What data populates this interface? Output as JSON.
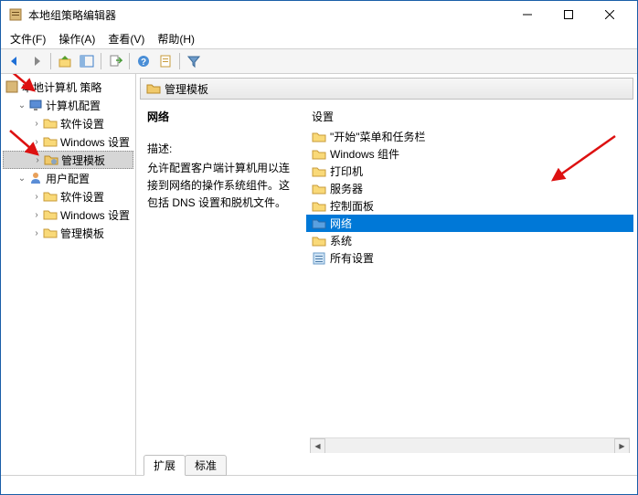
{
  "window": {
    "title": "本地组策略编辑器"
  },
  "menubar": {
    "file": "文件(F)",
    "action": "操作(A)",
    "view": "查看(V)",
    "help": "帮助(H)"
  },
  "tree": {
    "root": "本地计算机 策略",
    "computer_config": "计算机配置",
    "software_settings_1": "软件设置",
    "windows_settings_1": "Windows 设置",
    "admin_templates_1": "管理模板",
    "user_config": "用户配置",
    "software_settings_2": "软件设置",
    "windows_settings_2": "Windows 设置",
    "admin_templates_2": "管理模板"
  },
  "content": {
    "header": "管理模板",
    "details_title": "网络",
    "desc_label": "描述:",
    "description": "允许配置客户端计算机用以连接到网络的操作系统组件。这包括 DNS 设置和脱机文件。",
    "settings_label": "设置",
    "items": [
      "\"开始\"菜单和任务栏",
      "Windows 组件",
      "打印机",
      "服务器",
      "控制面板",
      "网络",
      "系统",
      "所有设置"
    ],
    "selected_index": 5
  },
  "tabs": {
    "extended": "扩展",
    "standard": "标准"
  }
}
